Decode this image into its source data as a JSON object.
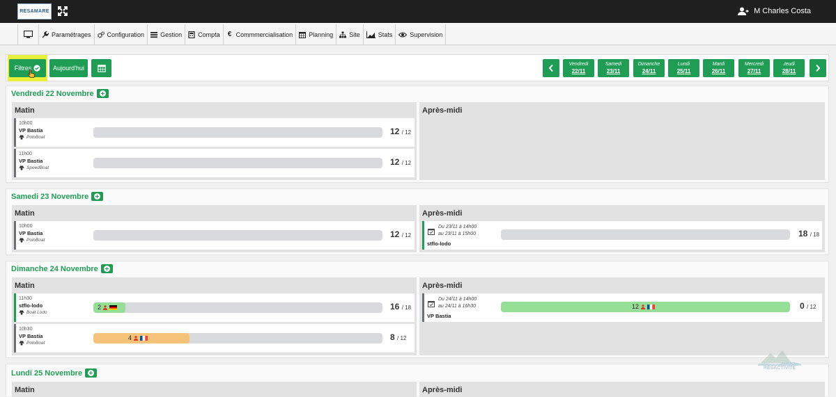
{
  "app": {
    "logo_text": "RESAMARE",
    "user_name": "M Charles Costa"
  },
  "menu": [
    {
      "label": "",
      "icon": "monitor-icon"
    },
    {
      "label": "Paramétrages",
      "icon": "wrench-icon"
    },
    {
      "label": "Configuration",
      "icon": "cogs-icon"
    },
    {
      "label": "Gestion",
      "icon": "list-icon"
    },
    {
      "label": "Compta",
      "icon": "calculator-icon"
    },
    {
      "label": "Commmercialisation",
      "icon": "euro-icon"
    },
    {
      "label": "Planning",
      "icon": "calendar-icon"
    },
    {
      "label": "Site",
      "icon": "sitemap-icon"
    },
    {
      "label": "Stats",
      "icon": "chart-icon"
    },
    {
      "label": "Supervision",
      "icon": "eye-icon"
    }
  ],
  "toolbar": {
    "filters_label": "Filtres",
    "today_label": "Aujourd'hui",
    "days": [
      {
        "name": "Vendredi",
        "date": "22/11"
      },
      {
        "name": "Samedi",
        "date": "23/11"
      },
      {
        "name": "Dimanche",
        "date": "24/11"
      },
      {
        "name": "Lundi",
        "date": "25/11"
      },
      {
        "name": "Mardi",
        "date": "26/11"
      },
      {
        "name": "Mercredi",
        "date": "27/11"
      },
      {
        "name": "Jeudi",
        "date": "28/11"
      }
    ]
  },
  "labels": {
    "morning": "Matin",
    "afternoon": "Après-midi"
  },
  "schedule": [
    {
      "title": "Vendredi 22 Novembre",
      "morning": [
        {
          "time": "10h00",
          "name": "VP Bastia",
          "boat": "PoloBoat",
          "available": "12",
          "total": "/ 12"
        },
        {
          "time": "11h00",
          "name": "VP Bastia",
          "boat": "SpeedBoat",
          "available": "12",
          "total": "/ 12"
        }
      ],
      "afternoon": []
    },
    {
      "title": "Samedi 23 Novembre",
      "morning": [
        {
          "time": "10h00",
          "name": "VP Bastia",
          "boat": "PoloBoat",
          "available": "12",
          "total": "/ 12"
        }
      ],
      "afternoon": [
        {
          "line1": "Du 23/11 à 14h00",
          "line2": "au 23/11 à 15h00",
          "name": "stflo-lodo",
          "available": "18",
          "total": "/ 18"
        }
      ]
    },
    {
      "title": "Dimanche 24 Novembre",
      "morning": [
        {
          "time": "11h30",
          "name": "stflo-lodo",
          "boat": "Boat Lodo",
          "booked": "2",
          "fill": 0.11,
          "flag": "de",
          "available": "16",
          "total": "/ 18"
        },
        {
          "time": "10h30",
          "name": "VP Bastia",
          "boat": "PoloBoat",
          "booked": "4",
          "fill": 0.333,
          "flag": "fr",
          "available": "8",
          "total": "/ 12"
        }
      ],
      "afternoon": [
        {
          "line1": "Du 24/11 à 14h00",
          "line2": "au 24/11 à 16h30",
          "name": "VP Bastia",
          "booked": "12",
          "fill": 1.0,
          "flag": "fr",
          "available": "0",
          "total": "/ 12"
        }
      ]
    },
    {
      "title": "Lundi 25 Novembre",
      "morning": [],
      "afternoon": []
    }
  ],
  "watermark": "RESACTIVITE",
  "colors": {
    "accent": "#1f9d55",
    "highlight": "#e6f03c",
    "orange_fill": "#f5c27a",
    "green_fill": "#95de95",
    "bar_bg": "#d9dadd"
  }
}
